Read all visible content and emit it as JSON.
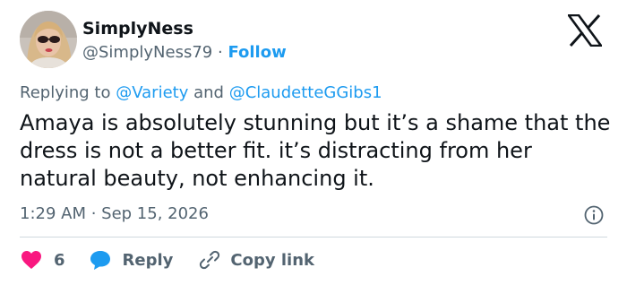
{
  "author": {
    "name": "SimplyNess",
    "handle": "@SimplyNess79",
    "separator": "·",
    "follow_label": "Follow",
    "avatar_icon": "profile-photo-icon"
  },
  "brand_icon": "x-logo-icon",
  "reply_context": {
    "prefix": "Replying to",
    "mention_1": "@Variety",
    "conjunction": "and",
    "mention_2": "@ClaudetteGGibs1"
  },
  "tweet": {
    "text": "Amaya is absolutely stunning but it’s a shame that the dress is not a better fit. it’s distracting from her natural beauty, not enhancing it.",
    "timestamp": "1:29 AM · Sep 15, 2026"
  },
  "actions": {
    "like_count": "6",
    "reply_label": "Reply",
    "copy_label": "Copy link"
  },
  "colors": {
    "accent": "#1d9bf0",
    "like": "#f91880",
    "text": "#0f1419",
    "muted": "#536471"
  }
}
